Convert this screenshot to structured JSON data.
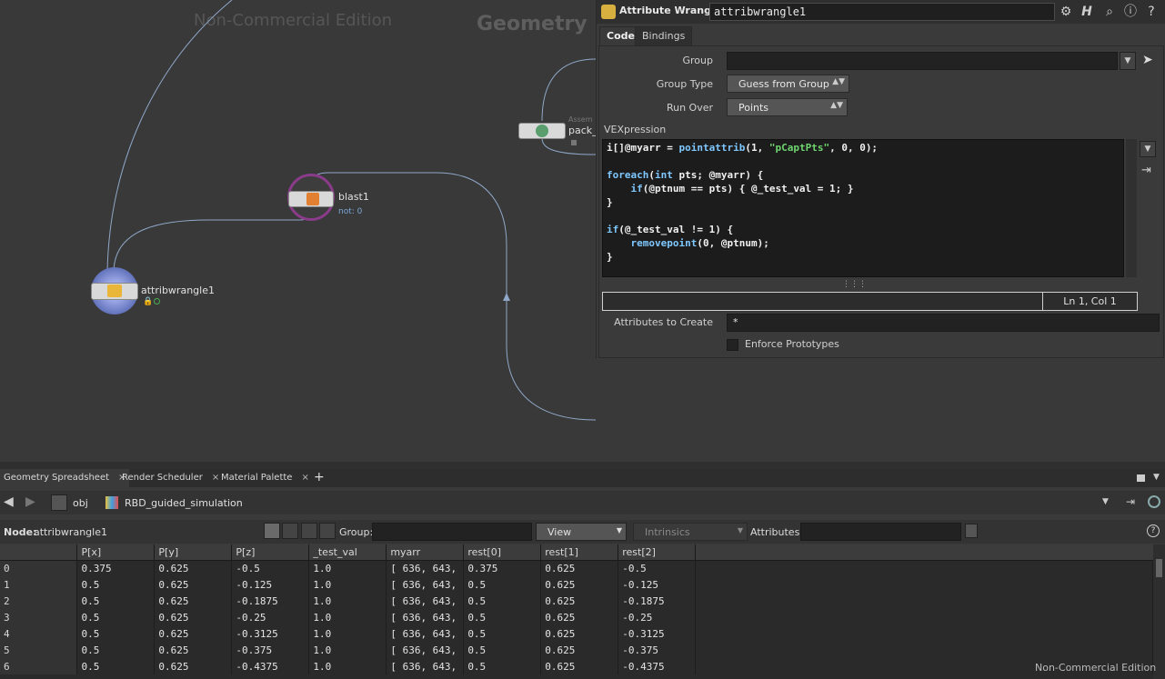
{
  "network": {
    "watermark": "Non-Commercial Edition",
    "context_label": "Geometry",
    "nodes": {
      "attribwrangle": {
        "label": "attribwrangle1"
      },
      "blast": {
        "label": "blast1",
        "sub": "not: 0"
      },
      "pack": {
        "label": "pack_",
        "sub": "Assem"
      }
    }
  },
  "params": {
    "node_type": "Attribute Wrangle",
    "node_name": "attribwrangle1",
    "tabs": [
      "Code",
      "Bindings"
    ],
    "group_label": "Group",
    "group_value": "",
    "group_type_label": "Group Type",
    "group_type_value": "Guess from Group",
    "run_over_label": "Run Over",
    "run_over_value": "Points",
    "vex_label": "VEXpression",
    "code_lines": [
      "i[]@myarr = pointattrib(1, \"pCaptPts\", 0, 0);",
      "",
      "foreach(int pts; @myarr) {",
      "    if(@ptnum == pts) { @_test_val = 1; }",
      "}",
      "",
      "if(@_test_val != 1) {",
      "    removepoint(0, @ptnum);",
      "}"
    ],
    "cursor_pos": "Ln 1, Col 1",
    "attr_create_label": "Attributes to Create",
    "attr_create_value": "*",
    "enforce_label": "Enforce Prototypes"
  },
  "lower": {
    "tabs": [
      "Geometry Spreadsheet",
      "Render Scheduler",
      "Material Palette"
    ],
    "path": [
      "obj",
      "RBD_guided_simulation"
    ],
    "node_label": "Node:",
    "node_value": "attribwrangle1",
    "group_label": "Group:",
    "view_label": "View",
    "intrinsics_label": "Intrinsics",
    "attributes_label": "Attributes:",
    "watermark": "Non-Commercial Edition",
    "columns": [
      "",
      "P[x]",
      "P[y]",
      "P[z]",
      "_test_val",
      "myarr",
      "rest[0]",
      "rest[1]",
      "rest[2]"
    ],
    "rows": [
      [
        "0",
        "0.375",
        "0.625",
        "-0.5",
        "1.0",
        "[ 636, 643,",
        "0.375",
        "0.625",
        "-0.5"
      ],
      [
        "1",
        "0.5",
        "0.625",
        "-0.125",
        "1.0",
        "[ 636, 643,",
        "0.5",
        "0.625",
        "-0.125"
      ],
      [
        "2",
        "0.5",
        "0.625",
        "-0.1875",
        "1.0",
        "[ 636, 643,",
        "0.5",
        "0.625",
        "-0.1875"
      ],
      [
        "3",
        "0.5",
        "0.625",
        "-0.25",
        "1.0",
        "[ 636, 643,",
        "0.5",
        "0.625",
        "-0.25"
      ],
      [
        "4",
        "0.5",
        "0.625",
        "-0.3125",
        "1.0",
        "[ 636, 643,",
        "0.5",
        "0.625",
        "-0.3125"
      ],
      [
        "5",
        "0.5",
        "0.625",
        "-0.375",
        "1.0",
        "[ 636, 643,",
        "0.5",
        "0.625",
        "-0.375"
      ],
      [
        "6",
        "0.5",
        "0.625",
        "-0.4375",
        "1.0",
        "[ 636, 643,",
        "0.5",
        "0.625",
        "-0.4375"
      ]
    ]
  }
}
